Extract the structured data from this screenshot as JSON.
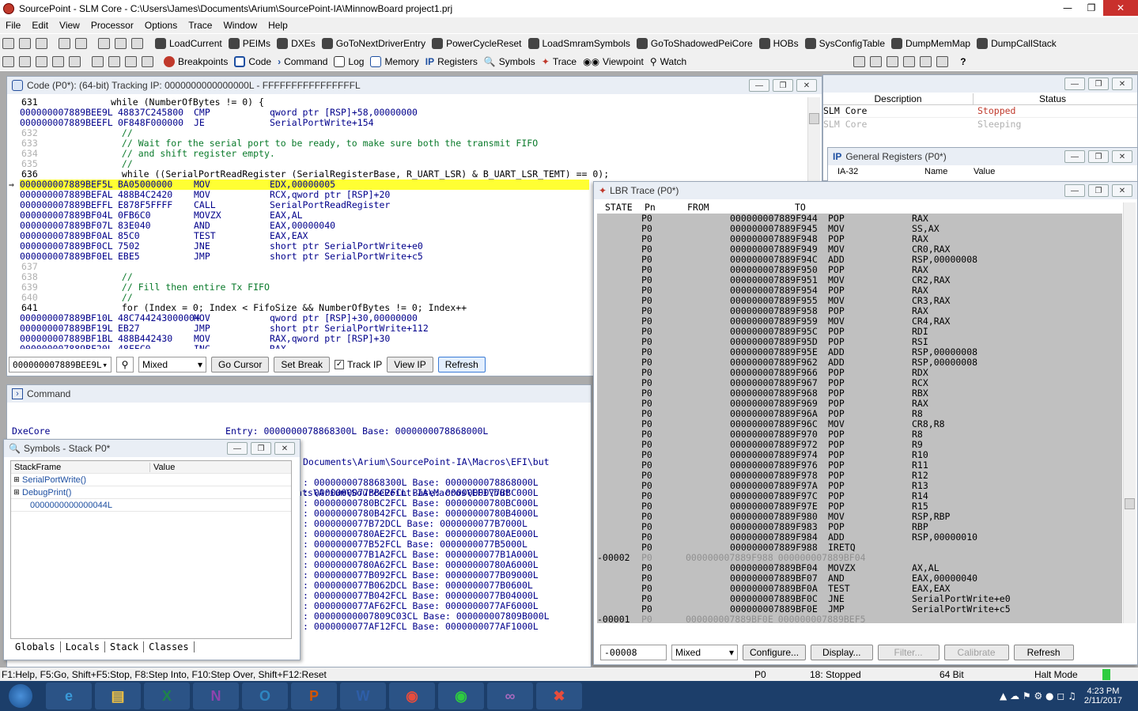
{
  "window": {
    "title": "SourcePoint - SLM Core - C:\\Users\\James\\Documents\\Arium\\SourcePoint-IA\\MinnowBoard project1.prj"
  },
  "menu": [
    "File",
    "Edit",
    "View",
    "Processor",
    "Options",
    "Trace",
    "Window",
    "Help"
  ],
  "toolbar1": [
    "LoadCurrent",
    "PEIMs",
    "DXEs",
    "GoToNextDriverEntry",
    "PowerCycleReset",
    "LoadSmramSymbols",
    "GoToShadowedPeiCore",
    "HOBs",
    "SysConfigTable",
    "DumpMemMap",
    "DumpCallStack"
  ],
  "toolbar2": [
    "Breakpoints",
    "Code",
    "Command",
    "Log",
    "Memory",
    "Registers",
    "Symbols",
    "Trace",
    "Viewpoint",
    "Watch"
  ],
  "code": {
    "title": "Code (P0*): (64-bit) Tracking IP: 0000000000000000L - FFFFFFFFFFFFFFFFL",
    "lines": [
      {
        "t": "src",
        "num": "631",
        "text": "            while (NumberOfBytes != 0) {"
      },
      {
        "t": "asm",
        "addr": "000000007889BEE9L",
        "bytes": "48837C245800",
        "mn": "CMP",
        "ops": "qword ptr [RSP]+58,00000000"
      },
      {
        "t": "asm",
        "addr": "000000007889BEEFL",
        "bytes": "0F848F000000",
        "mn": "JE",
        "ops": "SerialPortWrite+154"
      },
      {
        "t": "srcd",
        "num": "632",
        "text": "              //"
      },
      {
        "t": "srcd",
        "num": "633",
        "text": "              // Wait for the serial port to be ready, to make sure both the transmit FIFO"
      },
      {
        "t": "srcd",
        "num": "634",
        "text": "              // and shift register empty."
      },
      {
        "t": "srcd",
        "num": "635",
        "text": "              //"
      },
      {
        "t": "src",
        "num": "636",
        "text": "              while ((SerialPortReadRegister (SerialRegisterBase, R_UART_LSR) & B_UART_LSR_TEMT) == 0);"
      },
      {
        "t": "cur",
        "addr": "000000007889BEF5L",
        "bytes": "BA05000000",
        "mn": "MOV",
        "ops": "EDX,00000005"
      },
      {
        "t": "asm",
        "addr": "000000007889BEFAL",
        "bytes": "488B4C2420",
        "mn": "MOV",
        "ops": "RCX,qword ptr [RSP]+20"
      },
      {
        "t": "asm",
        "addr": "000000007889BEFFL",
        "bytes": "E878F5FFFF",
        "mn": "CALL",
        "ops": "SerialPortReadRegister"
      },
      {
        "t": "asm",
        "addr": "000000007889BF04L",
        "bytes": "0FB6C0",
        "mn": "MOVZX",
        "ops": "EAX,AL"
      },
      {
        "t": "asm",
        "addr": "000000007889BF07L",
        "bytes": "83E040",
        "mn": "AND",
        "ops": "EAX,00000040"
      },
      {
        "t": "asm",
        "addr": "000000007889BF0AL",
        "bytes": "85C0",
        "mn": "TEST",
        "ops": "EAX,EAX"
      },
      {
        "t": "asm",
        "addr": "000000007889BF0CL",
        "bytes": "7502",
        "mn": "JNE",
        "ops": "short ptr SerialPortWrite+e0"
      },
      {
        "t": "asm",
        "addr": "000000007889BF0EL",
        "bytes": "EBE5",
        "mn": "JMP",
        "ops": "short ptr SerialPortWrite+c5"
      },
      {
        "t": "srcd",
        "num": "637",
        "text": ""
      },
      {
        "t": "srcd",
        "num": "638",
        "text": "              //"
      },
      {
        "t": "srcd",
        "num": "639",
        "text": "              // Fill then entire Tx FIFO"
      },
      {
        "t": "srcd",
        "num": "640",
        "text": "              //"
      },
      {
        "t": "src",
        "num": "641",
        "text": "              for (Index = 0; Index < FifoSize && NumberOfBytes != 0; Index++"
      },
      {
        "t": "asm",
        "addr": "000000007889BF10L",
        "bytes": "48C74424300000+",
        "mn": "MOV",
        "ops": "qword ptr [RSP]+30,00000000"
      },
      {
        "t": "asm",
        "addr": "000000007889BF19L",
        "bytes": "EB27",
        "mn": "JMP",
        "ops": "short ptr SerialPortWrite+112"
      },
      {
        "t": "asm",
        "addr": "000000007889BF1BL",
        "bytes": "488B442430",
        "mn": "MOV",
        "ops": "RAX,qword ptr [RSP]+30"
      },
      {
        "t": "asm",
        "addr": "000000007889BF20L",
        "bytes": "48FFC0",
        "mn": "INC",
        "ops": "RAX"
      }
    ],
    "addr_combo": "000000007889BEE9L",
    "mode_combo": "Mixed",
    "go_cursor": "Go Cursor",
    "set_break": "Set Break",
    "track_ip": "Track IP",
    "view_ip": "View IP",
    "refresh": "Refresh"
  },
  "status_panel": {
    "headers": [
      "Description",
      "Status"
    ],
    "rows": [
      [
        "SLM Core",
        "Stopped"
      ],
      [
        "SLM Core",
        "Sleeping"
      ]
    ]
  },
  "gen_regs": {
    "title": "General Registers (P0*)",
    "cols": [
      "IA-32",
      "Name",
      "Value"
    ]
  },
  "command": {
    "title": "Command",
    "lines": [
      "DxeCore                                Entry: 0000000078868300L Base: 0000000078868000L",
      "P0>",
      "Loading User Defined Macro #1: C:\\Users\\James\\Documents\\Arium\\SourcePoint-IA\\Macros\\EFI\\but"
    ],
    "right_lines": [
      "Documents\\Arium\\SourcePoint-IA\\Macros\\EFI\\but",
      "",
      ": 0000000078868300L Base: 0000000078868000L",
      ": 0000000077BBC2FCL Base: 0000000077BBC000L",
      ": 00000000780BC2FCL Base: 00000000780BC000L",
      ": 00000000780B42FCL Base: 00000000780B4000L",
      ": 0000000077B72DCL Base: 0000000077B7000L",
      ": 00000000780AE2FCL Base: 00000000780AE000L",
      ": 0000000077B52FCL Base: 0000000077B5000L",
      ": 0000000077B1A2FCL Base: 0000000077B1A000L",
      ": 00000000780A62FCL Base: 00000000780A6000L",
      ": 0000000077B092FCL Base: 0000000077B09000L",
      ": 0000000077B062DCL Base: 0000000077B0600L",
      ": 0000000077B042FCL Base: 0000000077B04000L",
      ": 0000000077AF62FCL Base: 0000000077AF6000L",
      ": 00000000007809C03CL Base: 000000007809B000L",
      ": 0000000077AF12FCL Base: 0000000077AF1000L"
    ]
  },
  "symbols": {
    "title": "Symbols - Stack P0*",
    "headers": [
      "StackFrame",
      "Value"
    ],
    "rows": [
      "SerialPortWrite()",
      "DebugPrint()",
      "0000000000000044L"
    ],
    "tabs": [
      "Globals",
      "Locals",
      "Stack",
      "Classes"
    ]
  },
  "lbr": {
    "title": "LBR Trace (P0*)",
    "headers": [
      "STATE",
      "Pn",
      "FROM",
      "TO"
    ],
    "rows": [
      [
        "",
        "P0",
        "",
        "000000007889F944",
        "POP",
        "RAX"
      ],
      [
        "",
        "P0",
        "",
        "000000007889F945",
        "MOV",
        "SS,AX"
      ],
      [
        "",
        "P0",
        "",
        "000000007889F948",
        "POP",
        "RAX"
      ],
      [
        "",
        "P0",
        "",
        "000000007889F949",
        "MOV",
        "CR0,RAX"
      ],
      [
        "",
        "P0",
        "",
        "000000007889F94C",
        "ADD",
        "RSP,00000008"
      ],
      [
        "",
        "P0",
        "",
        "000000007889F950",
        "POP",
        "RAX"
      ],
      [
        "",
        "P0",
        "",
        "000000007889F951",
        "MOV",
        "CR2,RAX"
      ],
      [
        "",
        "P0",
        "",
        "000000007889F954",
        "POP",
        "RAX"
      ],
      [
        "",
        "P0",
        "",
        "000000007889F955",
        "MOV",
        "CR3,RAX"
      ],
      [
        "",
        "P0",
        "",
        "000000007889F958",
        "POP",
        "RAX"
      ],
      [
        "",
        "P0",
        "",
        "000000007889F959",
        "MOV",
        "CR4,RAX"
      ],
      [
        "",
        "P0",
        "",
        "000000007889F95C",
        "POP",
        "RDI"
      ],
      [
        "",
        "P0",
        "",
        "000000007889F95D",
        "POP",
        "RSI"
      ],
      [
        "",
        "P0",
        "",
        "000000007889F95E",
        "ADD",
        "RSP,00000008"
      ],
      [
        "",
        "P0",
        "",
        "000000007889F962",
        "ADD",
        "RSP,00000008"
      ],
      [
        "",
        "P0",
        "",
        "000000007889F966",
        "POP",
        "RDX"
      ],
      [
        "",
        "P0",
        "",
        "000000007889F967",
        "POP",
        "RCX"
      ],
      [
        "",
        "P0",
        "",
        "000000007889F968",
        "POP",
        "RBX"
      ],
      [
        "",
        "P0",
        "",
        "000000007889F969",
        "POP",
        "RAX"
      ],
      [
        "",
        "P0",
        "",
        "000000007889F96A",
        "POP",
        "R8"
      ],
      [
        "",
        "P0",
        "",
        "000000007889F96C",
        "MOV",
        "CR8,R8"
      ],
      [
        "",
        "P0",
        "",
        "000000007889F970",
        "POP",
        "R8"
      ],
      [
        "",
        "P0",
        "",
        "000000007889F972",
        "POP",
        "R9"
      ],
      [
        "",
        "P0",
        "",
        "000000007889F974",
        "POP",
        "R10"
      ],
      [
        "",
        "P0",
        "",
        "000000007889F976",
        "POP",
        "R11"
      ],
      [
        "",
        "P0",
        "",
        "000000007889F978",
        "POP",
        "R12"
      ],
      [
        "",
        "P0",
        "",
        "000000007889F97A",
        "POP",
        "R13"
      ],
      [
        "",
        "P0",
        "",
        "000000007889F97C",
        "POP",
        "R14"
      ],
      [
        "",
        "P0",
        "",
        "000000007889F97E",
        "POP",
        "R15"
      ],
      [
        "",
        "P0",
        "",
        "000000007889F980",
        "MOV",
        "RSP,RBP"
      ],
      [
        "",
        "P0",
        "",
        "000000007889F983",
        "POP",
        "RBP"
      ],
      [
        "",
        "P0",
        "",
        "000000007889F984",
        "ADD",
        "RSP,00000010"
      ],
      [
        "",
        "P0",
        "",
        "000000007889F988",
        "IRETQ",
        ""
      ],
      [
        "-00002",
        "P0",
        "000000007889F988",
        "000000007889BF04",
        "",
        ""
      ],
      [
        "",
        "P0",
        "",
        "000000007889BF04",
        "MOVZX",
        "AX,AL"
      ],
      [
        "",
        "P0",
        "",
        "000000007889BF07",
        "AND",
        "EAX,00000040"
      ],
      [
        "",
        "P0",
        "",
        "000000007889BF0A",
        "TEST",
        "EAX,EAX"
      ],
      [
        "",
        "P0",
        "",
        "000000007889BF0C",
        "JNE",
        "SerialPortWrite+e0"
      ],
      [
        "",
        "P0",
        "",
        "000000007889BF0E",
        "JMP",
        "SerialPortWrite+c5"
      ],
      [
        "-00001",
        "P0",
        "000000007889BF0E",
        "000000007889BEF5",
        "",
        ""
      ]
    ],
    "index_field": "-00008",
    "mode_combo": "Mixed",
    "configure": "Configure...",
    "display": "Display...",
    "filter": "Filter...",
    "calibrate": "Calibrate",
    "refresh": "Refresh"
  },
  "statusbar": {
    "help": "F1:Help, F5:Go, Shift+F5:Stop, F8:Step Into, F10:Step Over, Shift+F12:Reset",
    "proc": "P0",
    "state": "18: Stopped",
    "bits": "64 Bit",
    "mode": "Halt Mode"
  },
  "taskbar": {
    "time": "4:23 PM",
    "date": "2/11/2017"
  },
  "colors": {
    "highlight": "#ffff33",
    "panel_title": "#e9eef5",
    "taskbar": "#1c3e6a",
    "lbr_bg": "#c0c0c0"
  }
}
